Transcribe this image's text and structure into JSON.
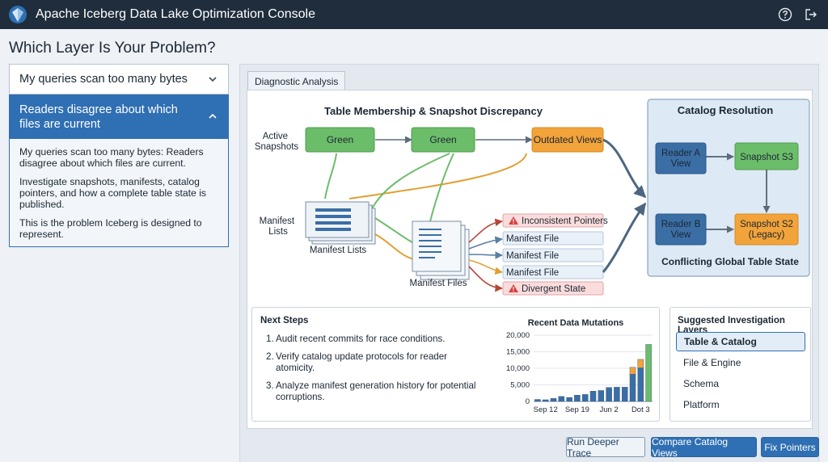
{
  "app": {
    "title": "Apache Iceberg Data Lake Optimization Console"
  },
  "page": {
    "title": "Which Layer Is Your Problem?"
  },
  "sidebar": {
    "collapsed_item": "My queries scan too many bytes",
    "open_item": {
      "title": "Readers disagree about which files are current",
      "paragraphs": [
        "My queries scan too many bytes: Readers disagree about which files are current.",
        "Investigate snapshots, manifests, catalog pointers, and how a complete table state is published.",
        "This is the problem Iceberg is designed to represent."
      ]
    }
  },
  "tab": {
    "label": "Diagnostic Analysis"
  },
  "diagram": {
    "title": "Table Membership & Snapshot Discrepancy",
    "row_labels": {
      "active": [
        "Active",
        "Snapshots"
      ],
      "manifest": [
        "Manifest",
        "Lists"
      ]
    },
    "nodes": {
      "snap1": "Green",
      "snap2": "Green",
      "outdated": "Outdated Views"
    },
    "manifest_lists_label": "Manifest Lists",
    "manifest_files_label": "Manifest Files",
    "file_rows": [
      {
        "label": "Inconsistent Pointers",
        "type": "warning"
      },
      {
        "label": "Manifest File",
        "type": "normal"
      },
      {
        "label": "Manifest File",
        "type": "normal"
      },
      {
        "label": "Manifest File",
        "type": "normal"
      },
      {
        "label": "Divergent State",
        "type": "warning"
      }
    ]
  },
  "catalog": {
    "title": "Catalog Resolution",
    "reader_a": [
      "Reader A",
      "View"
    ],
    "reader_b": [
      "Reader B",
      "View"
    ],
    "snapshot_s3": "Snapshot S3",
    "snapshot_s2": [
      "Snapshot S2",
      "(Legacy)"
    ],
    "footer": "Conflicting Global Table State"
  },
  "next_steps": {
    "title": "Next Steps",
    "items": [
      {
        "num": "1.",
        "text": "Audit recent commits for race conditions."
      },
      {
        "num": "2.",
        "text": "Verify catalog update protocols for reader atomicity."
      },
      {
        "num": "3.",
        "text": "Analyze manifest generation history for potential corruptions."
      }
    ]
  },
  "chart_data": {
    "type": "bar",
    "title": "Recent Data Mutations",
    "ylim": [
      0,
      20000
    ],
    "yticks": [
      "20,000",
      "15,000",
      "10,000",
      "5,000",
      "0"
    ],
    "ytick_values": [
      20000,
      15000,
      10000,
      5000,
      0
    ],
    "xtick_labels": [
      "Sep 12",
      "Sep 19",
      "Jun 2",
      "Dot 3"
    ],
    "xtick_indices": [
      1,
      5,
      9,
      13
    ],
    "series": [
      {
        "values": [
          600,
          500,
          900,
          1500,
          1200,
          1900,
          2100,
          3100,
          3300,
          4200,
          4300,
          4300,
          8200,
          10100,
          0
        ]
      },
      {
        "values": [
          0,
          0,
          0,
          0,
          0,
          0,
          0,
          0,
          0,
          0,
          0,
          0,
          2100,
          2600,
          0
        ]
      },
      {
        "values": [
          0,
          0,
          0,
          0,
          0,
          0,
          0,
          0,
          0,
          0,
          0,
          0,
          0,
          0,
          17200
        ]
      }
    ],
    "colors": [
      "#3b6ea5",
      "#f2a33a",
      "#6cbd6a"
    ]
  },
  "layers": {
    "title": "Suggested Investigation Layers",
    "items": [
      "Table & Catalog",
      "File & Engine",
      "Schema",
      "Platform"
    ]
  },
  "buttons": {
    "trace": "Run Deeper Trace",
    "compare": "Compare Catalog Views",
    "fix": "Fix Pointers"
  },
  "colors": {
    "header": "#1f2d3d",
    "accent": "#2f6fb3",
    "green": "#6cbd6a",
    "orange": "#f2a33a",
    "warning_red": "#d94141",
    "catalog_bg": "#dde9f4"
  }
}
